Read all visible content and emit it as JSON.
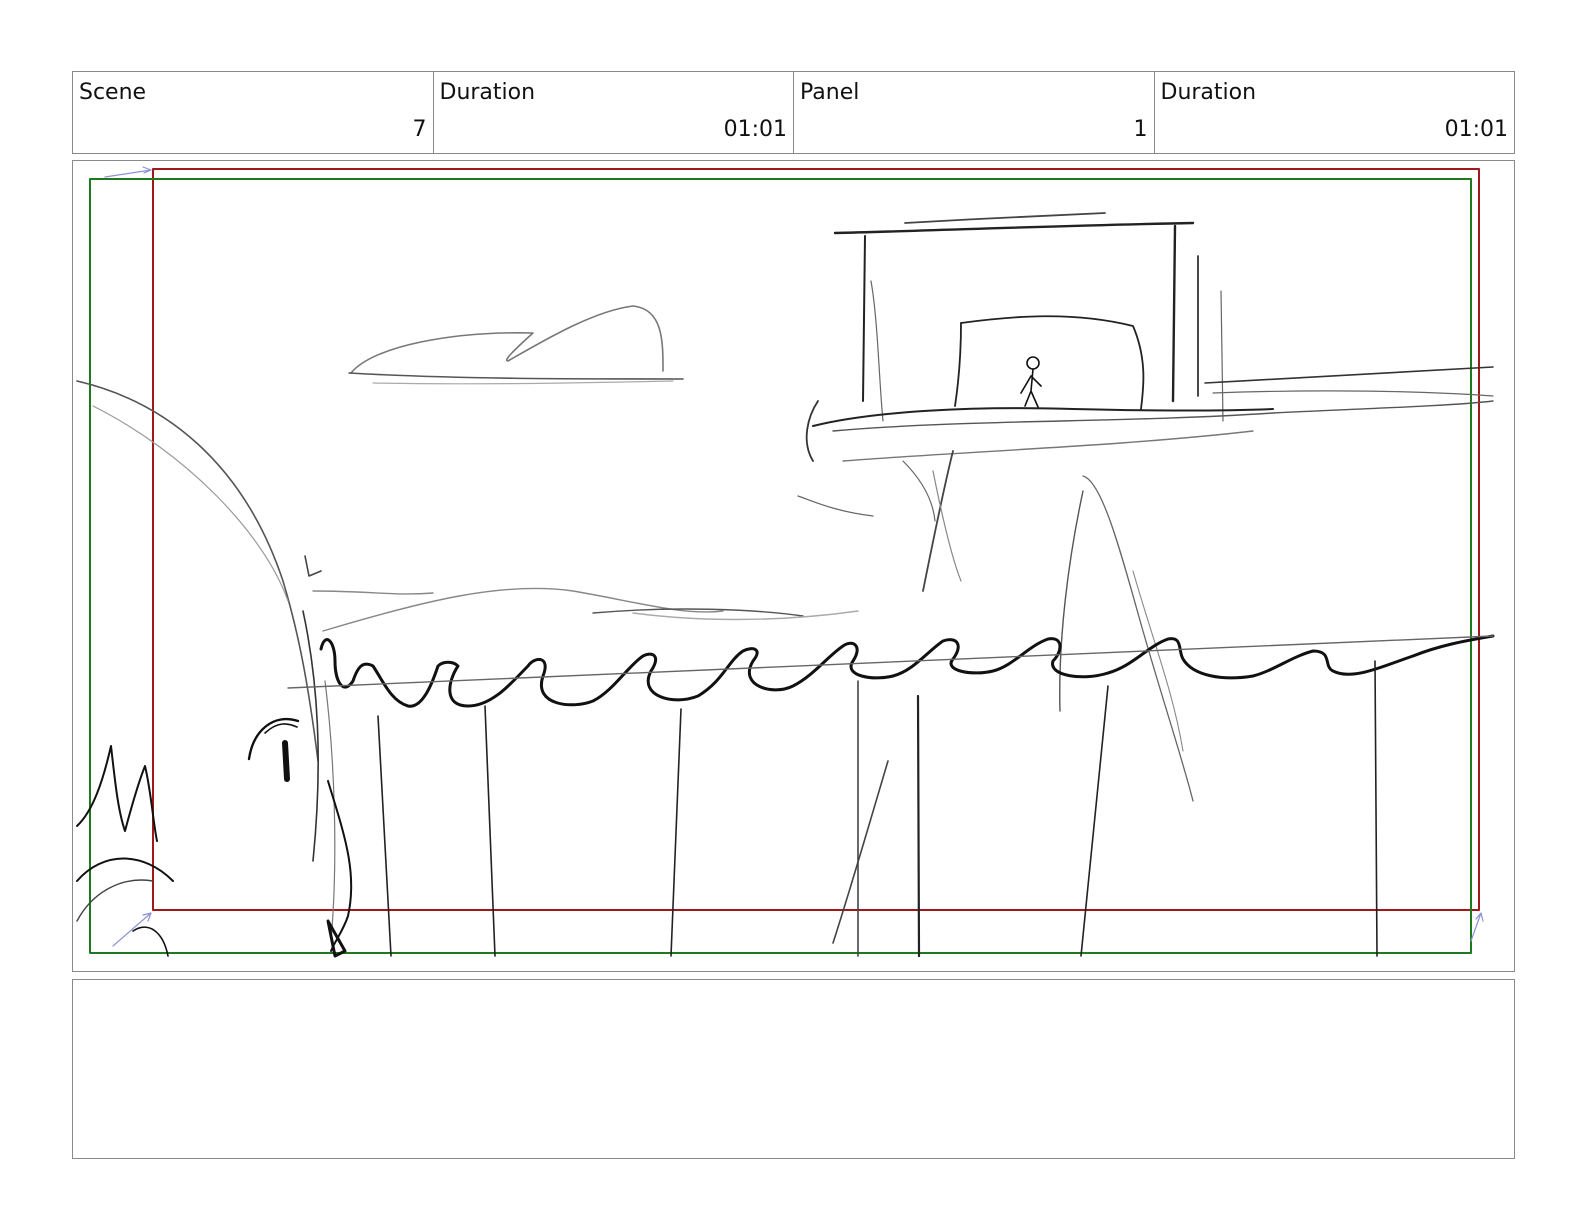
{
  "header": {
    "cells": [
      {
        "label": "Scene",
        "value": "7"
      },
      {
        "label": "Duration",
        "value": "01:01"
      },
      {
        "label": "Panel",
        "value": "1"
      },
      {
        "label": "Duration",
        "value": "01:01"
      }
    ]
  },
  "frame_colors": {
    "action_safe": "#1f7a1f",
    "title_safe": "#a01818"
  },
  "notes": {
    "text": ""
  }
}
